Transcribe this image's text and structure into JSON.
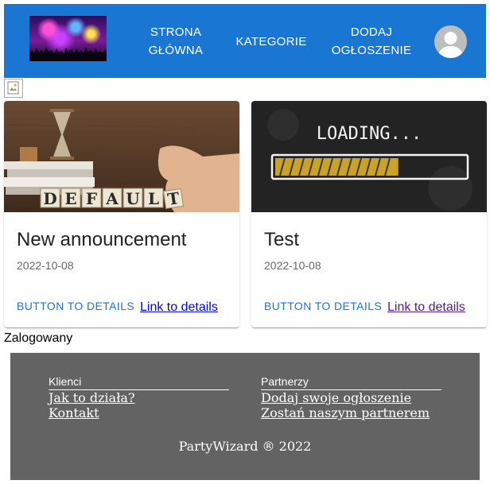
{
  "nav": {
    "home_line1": "STRONA",
    "home_line2": "GŁÓWNA",
    "categories": "KATEGORIE",
    "add_line1": "DODAJ",
    "add_line2": "OGŁOSZENIE"
  },
  "colors": {
    "appbar": "#1976d2",
    "footer": "#636363",
    "accent_button": "#1976d2"
  },
  "cards": [
    {
      "image_text": "DEFAULT",
      "title": "New announcement",
      "date": "2022-10-08",
      "button": "BUTTON TO DETAILS",
      "link": "Link to details"
    },
    {
      "image_text": "LOADING...",
      "progress": 0.65,
      "title": "Test",
      "date": "2022-10-08",
      "button": "BUTTON TO DETAILS",
      "link": "Link to details"
    }
  ],
  "status": "Zalogowany",
  "footer": {
    "col1_heading": "Klienci",
    "col1_links": [
      "Jak to działa?",
      "Kontakt"
    ],
    "col2_heading": "Partnerzy",
    "col2_links": [
      "Dodaj swoje ogłoszenie",
      "Zostań naszym partnerem"
    ],
    "copyright": "PartyWizard ® 2022"
  },
  "icons": {
    "avatar": "person-icon",
    "broken_image": "broken-image-icon"
  }
}
